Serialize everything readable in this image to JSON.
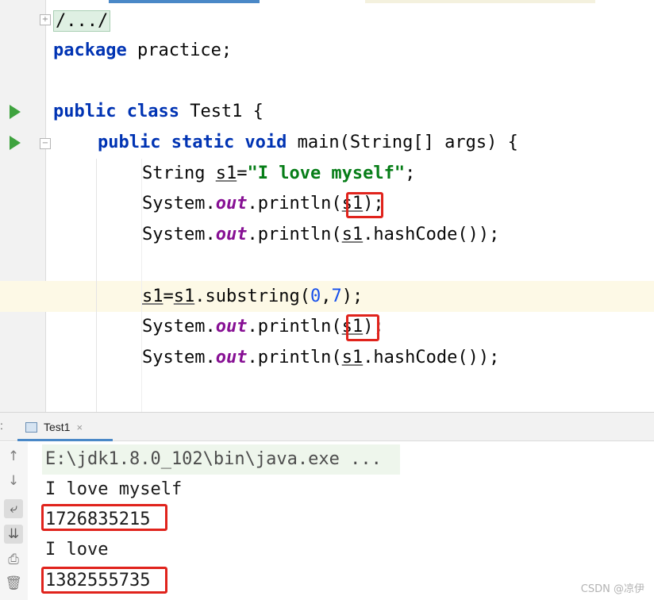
{
  "editor": {
    "fold_collapsed_text": "/.../",
    "line_package": {
      "kw": "package",
      "rest": " practice;"
    },
    "line_class": {
      "kw": "public class",
      "rest": " Test1 {"
    },
    "line_main": {
      "kw": "public static void",
      "rest": " main(String[] args) {"
    },
    "line_string_decl": {
      "type": "String ",
      "var": "s1",
      "eq": "=",
      "str": "\"I love myself\"",
      "end": ";"
    },
    "println_a": {
      "obj": "System.",
      "field": "out",
      "call": ".println(",
      "arg": "s1",
      "end": ");"
    },
    "println_hash_a": {
      "obj": "System.",
      "field": "out",
      "call": ".println(",
      "arg": "s1",
      "end": ".hashCode());"
    },
    "line_substring": {
      "var": "s1",
      "eq": "=",
      "var2": "s1",
      "call": ".substring(",
      "n1": "0",
      "comma": ",",
      "n2": "7",
      "end": ");"
    },
    "println_b": {
      "obj": "System.",
      "field": "out",
      "call": ".println(",
      "arg": "s1",
      "end": ");"
    },
    "println_hash_b": {
      "obj": "System.",
      "field": "out",
      "call": ".println(",
      "arg": "s1",
      "end": ".hashCode());"
    }
  },
  "console": {
    "left_marker": ":",
    "tab_label": "Test1",
    "tab_close": "×",
    "command": "E:\\jdk1.8.0_102\\bin\\java.exe ...",
    "output": [
      "I love myself",
      "1726835215",
      "I love",
      "1382555735"
    ],
    "watermark": "CSDN @凉伊"
  },
  "icons": [
    "run-arrow-icon",
    "fold-marker-icon",
    "file-icon",
    "close-icon",
    "arrow-up-icon",
    "arrow-down-icon",
    "soft-wrap-icon",
    "scroll-to-end-icon",
    "print-icon",
    "trash-icon"
  ],
  "colors": {
    "keyword": "#0033b3",
    "string": "#067d17",
    "number": "#1750eb",
    "static_field": "#871094",
    "highlight_box": "#e0231c",
    "run_arrow": "#3fa33f"
  }
}
